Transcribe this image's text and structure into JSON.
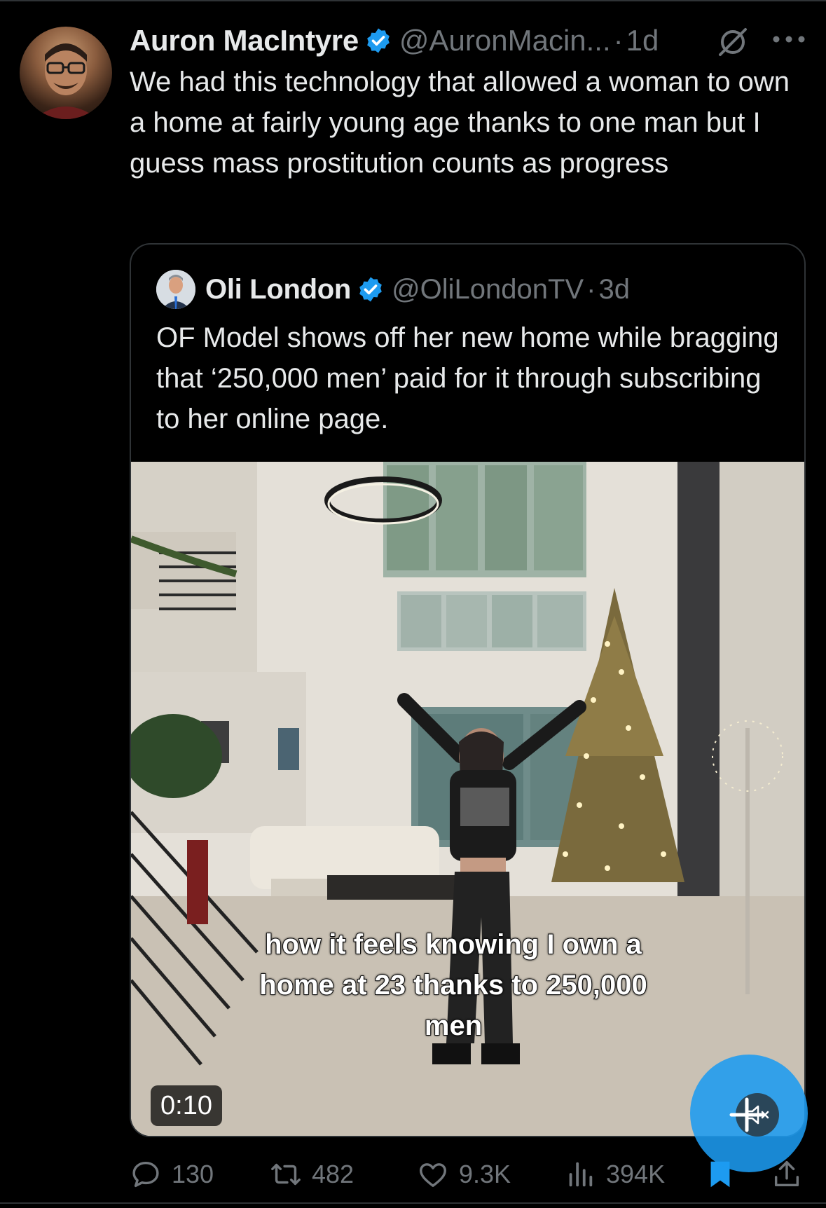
{
  "post": {
    "author_name": "Auron MacIntyre",
    "author_handle": "@AuronMacin...",
    "separator": "·",
    "time": "1d",
    "text": "We had this technology that allowed a woman to own a home at fairly young age thanks to one man but I guess mass prostitution counts as progress"
  },
  "quote": {
    "author_name": "Oli London",
    "author_handle": "@OliLondonTV",
    "separator": "·",
    "time": "3d",
    "text": "OF Model shows off her new home while bragging that ‘250,000 men’ paid for it through subscribing to her online page.",
    "video": {
      "caption": "how it feels knowing I own a home at 23 thanks to 250,000 men",
      "timestamp": "0:10"
    }
  },
  "actions": {
    "replies": "130",
    "reposts": "482",
    "likes": "9.3K",
    "views": "394K"
  },
  "icons": [
    "verified-badge-icon",
    "grok-icon",
    "more-icon",
    "reply-icon",
    "repost-icon",
    "like-icon",
    "views-icon",
    "bookmark-icon",
    "share-icon",
    "mute-icon",
    "compose-plus-icon"
  ],
  "colors": {
    "background": "#000000",
    "text": "#e7e9ea",
    "muted": "#71767b",
    "accent": "#1d9bf0",
    "border": "#2f3336"
  }
}
